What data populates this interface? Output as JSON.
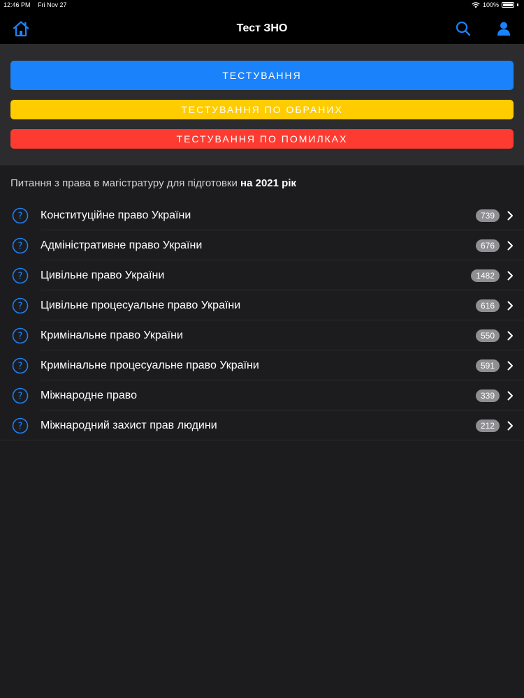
{
  "status_bar": {
    "time": "12:46 PM",
    "date": "Fri Nov 27",
    "battery": "100%"
  },
  "navbar": {
    "title": "Тест ЗНО",
    "home_icon": "home-icon",
    "search_icon": "search-icon",
    "user_icon": "user-icon"
  },
  "buttons": {
    "test_label": "ТЕСТУВАННЯ",
    "favorites_label": "ТЕСТУВАННЯ ПО ОБРАНИХ",
    "errors_label": "ТЕСТУВАННЯ ПО ПОМИЛКАХ"
  },
  "section": {
    "text": "Питання з права в магістратуру для підготовки ",
    "bold": "на 2021 рік"
  },
  "items": [
    {
      "label": "Конституційне право України",
      "count": "739"
    },
    {
      "label": "Адміністративне право України",
      "count": "676"
    },
    {
      "label": "Цивільне право України",
      "count": "1482"
    },
    {
      "label": "Цивільне процесуальне право України",
      "count": "616"
    },
    {
      "label": "Кримінальне право України",
      "count": "550"
    },
    {
      "label": "Кримінальне процесуальне право України",
      "count": "591"
    },
    {
      "label": "Міжнародне право",
      "count": "339"
    },
    {
      "label": "Міжнародний захист прав людини",
      "count": "212"
    }
  ],
  "colors": {
    "accent_blue": "#1a82fb",
    "yellow": "#ffcc00",
    "red": "#fd3b30",
    "background": "#1c1c1e",
    "badge": "#8e8e93"
  }
}
